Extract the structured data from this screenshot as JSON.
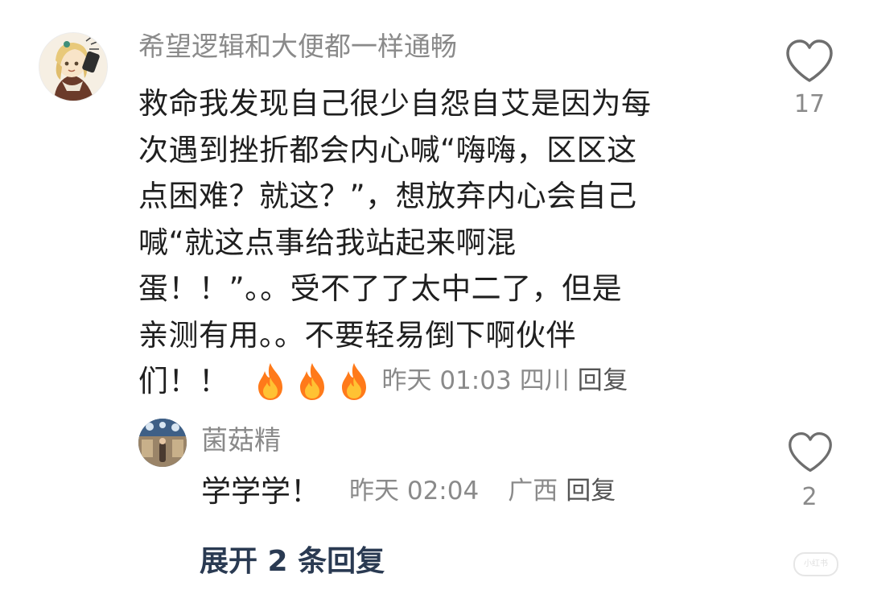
{
  "comment": {
    "username": "希望逻辑和大便都一样通畅",
    "lines": [
      "救命我发现自己很少自怨自艾是因为每",
      "次遇到挫折都会内心喊“嗨嗨，区区这",
      "点困难？就这？”，想放弃内心会自己",
      "喊“就这点事给我站起来啊混",
      "蛋！！”。。受不了了太中二了，但是",
      "亲测有用。。不要轻易倒下啊伙伴"
    ],
    "last_line_text": "们！！",
    "emoji": [
      "fire-emoji",
      "fire-emoji",
      "fire-emoji"
    ],
    "time": "昨天 01:03",
    "location": "四川",
    "reply_label": "回复",
    "like_icon": "heart-outline-icon",
    "like_count": "17"
  },
  "reply": {
    "username": "菌菇精",
    "text": "学学学！",
    "time": "昨天 02:04",
    "location": "广西",
    "reply_label": "回复",
    "like_icon": "heart-outline-icon",
    "like_count": "2"
  },
  "expand_label": "展开 2 条回复",
  "watermark": {
    "logo_text": "小红书"
  },
  "colors": {
    "text": "#1f1f1f",
    "meta": "#8a8a8a",
    "expand": "#2a3a52",
    "fire": "#ff7a1a"
  }
}
